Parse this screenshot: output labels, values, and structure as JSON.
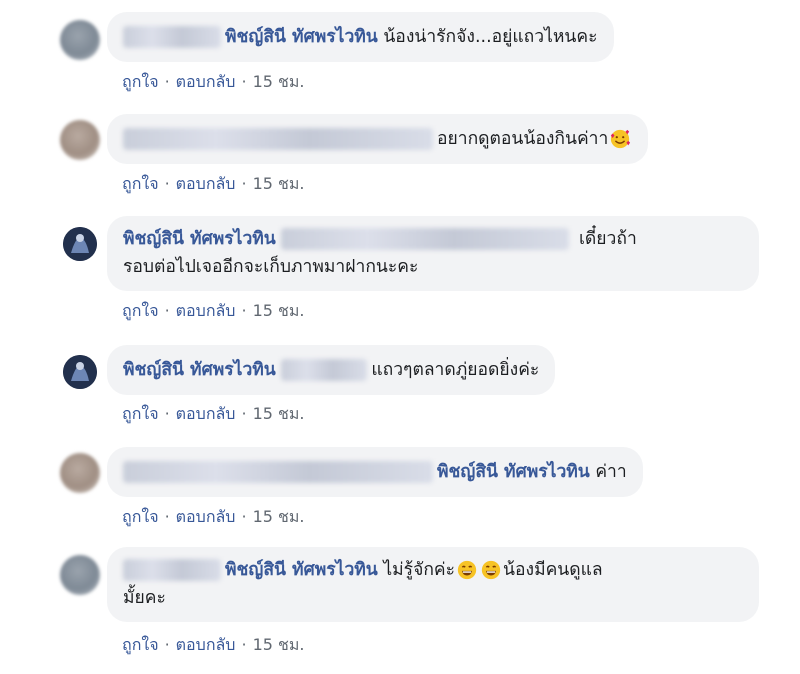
{
  "comments": [
    {
      "tag": "พิชญ์สินี ทัศพรไวทิน",
      "text": " น้องน่ารักจัง...อยู่แถวไหนคะ",
      "like": "ถูกใจ",
      "reply": "ตอบกลับ",
      "time": "15 ชม."
    },
    {
      "text": "อยากดูตอนน้องกินค่าา",
      "emoji": "smiling-face-with-hearts",
      "like": "ถูกใจ",
      "reply": "ตอบกลับ",
      "time": "15 ชม."
    },
    {
      "author": "พิชญ์สินี ทัศพรไวทิน",
      "text_line1": "เดี๋ยวถ้า",
      "text_line2": "รอบต่อไปเจออีกจะเก็บภาพมาฝากนะคะ",
      "like": "ถูกใจ",
      "reply": "ตอบกลับ",
      "time": "15 ชม."
    },
    {
      "author": "พิชญ์สินี ทัศพรไวทิน",
      "text": "แถวๆตลาดภู่ยอดยิ่งค่ะ",
      "like": "ถูกใจ",
      "reply": "ตอบกลับ",
      "time": "15 ชม."
    },
    {
      "tag": "พิชญ์สินี ทัศพรไวทิน",
      "text": " ค่าา",
      "like": "ถูกใจ",
      "reply": "ตอบกลับ",
      "time": "15 ชม."
    },
    {
      "tag": "พิชญ์สินี ทัศพรไวทิน",
      "text_a": " ไม่รู้จักค่ะ",
      "emoji": "grinning-face-with-smiling-eyes",
      "text_b": "น้องมีคนดูแล",
      "text_line2": "มั้ยคะ",
      "like": "ถูกใจ",
      "reply": "ตอบกลับ",
      "time": "15 ชม."
    }
  ],
  "separator": "·",
  "colors": {
    "link": "#385898",
    "muted": "#606770",
    "bubble": "#f2f3f5"
  }
}
